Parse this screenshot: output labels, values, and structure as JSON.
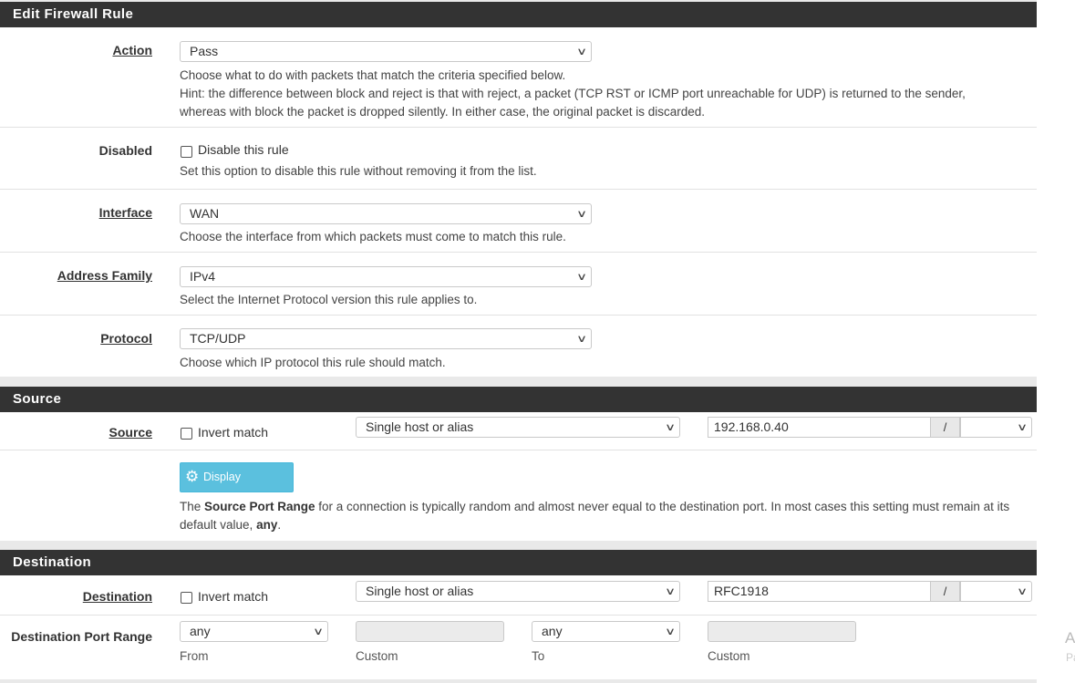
{
  "panels": {
    "edit": {
      "title": "Edit Firewall Rule",
      "action": {
        "label": "Action",
        "value": "Pass",
        "help1": "Choose what to do with packets that match the criteria specified below.",
        "help2": "Hint: the difference between block and reject is that with reject, a packet (TCP RST or ICMP port unreachable for UDP) is returned to the sender,",
        "help3": "whereas with block the packet is dropped silently. In either case, the original packet is discarded."
      },
      "disabled": {
        "label": "Disabled",
        "checkbox_label": "Disable this rule",
        "help": "Set this option to disable this rule without removing it from the list."
      },
      "interface": {
        "label": "Interface",
        "value": "WAN",
        "help": "Choose the interface from which packets must come to match this rule."
      },
      "address_family": {
        "label": "Address Family",
        "value": "IPv4",
        "help": "Select the Internet Protocol version this rule applies to."
      },
      "protocol": {
        "label": "Protocol",
        "value": "TCP/UDP",
        "help": "Choose which IP protocol this rule should match."
      }
    },
    "source": {
      "title": "Source",
      "label": "Source",
      "invert_label": "Invert match",
      "type_value": "Single host or alias",
      "address_value": "192.168.0.40",
      "slash": "/",
      "mask_value": "",
      "advanced_button": "Display Advanced",
      "help_pre": "The ",
      "help_bold": "Source Port Range",
      "help_mid": " for a connection is typically random and almost never equal to the destination port. In most cases this setting must remain at its default value, ",
      "help_bold2": "any",
      "help_post": "."
    },
    "destination": {
      "title": "Destination",
      "label": "Destination",
      "invert_label": "Invert match",
      "type_value": "Single host or alias",
      "address_value": "RFC1918",
      "slash": "/",
      "mask_value": "",
      "port_range": {
        "label": "Destination Port Range",
        "from_value": "any",
        "from_label": "From",
        "from_custom_label": "Custom",
        "to_value": "any",
        "to_label": "To",
        "to_custom_label": "Custom"
      }
    }
  },
  "side_text": {
    "t1": "A",
    "t2": "Pa"
  },
  "icons": {
    "chevron": "chevron-down-icon",
    "gear": "gear-icon"
  },
  "colors": {
    "header_bg": "#333333",
    "info_button": "#5bc0de"
  }
}
